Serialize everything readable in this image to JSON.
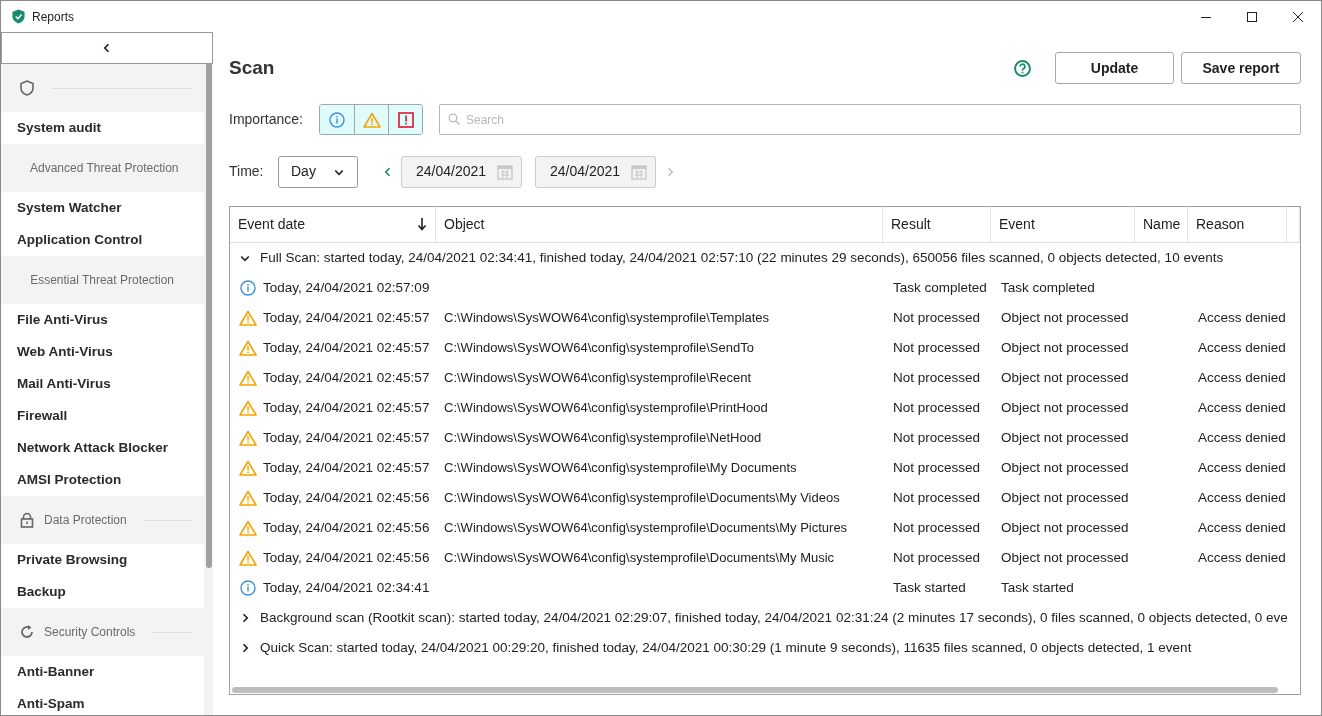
{
  "window": {
    "title": "Reports"
  },
  "sidebar": {
    "groups": [
      {
        "items": [
          "System audit"
        ]
      },
      {
        "label": "Advanced Threat Protection",
        "items": [
          "System Watcher",
          "Application Control"
        ]
      },
      {
        "label": "Essential Threat Protection",
        "items": [
          "File Anti-Virus",
          "Web Anti-Virus",
          "Mail Anti-Virus",
          "Firewall",
          "Network Attack Blocker",
          "AMSI Protection"
        ]
      },
      {
        "label": "Data Protection",
        "items": [
          "Private Browsing",
          "Backup"
        ]
      },
      {
        "label": "Security Controls",
        "items": [
          "Anti-Banner",
          "Anti-Spam"
        ]
      }
    ]
  },
  "page": {
    "title": "Scan",
    "buttons": [
      "Update",
      "Save report"
    ]
  },
  "importance": {
    "label": "Importance:",
    "filters": [
      {
        "kind": "info",
        "selected": true
      },
      {
        "kind": "warning",
        "selected": true
      },
      {
        "kind": "error",
        "selected": true
      }
    ]
  },
  "search": {
    "placeholder": "Search"
  },
  "time": {
    "label": "Time:",
    "period": "Day",
    "from": "24/04/2021",
    "to": "24/04/2021"
  },
  "table": {
    "columns": [
      "Event date",
      "Object",
      "Result",
      "Event",
      "Name",
      "Reason"
    ],
    "groups": [
      {
        "expanded": true,
        "text": "Full Scan: started today, 24/04/2021 02:34:41, finished today, 24/04/2021 02:57:10 (22 minutes 29 seconds), 650056 files scanned, 0 objects detected, 10 events",
        "rows": [
          {
            "kind": "info",
            "date": "Today, 24/04/2021 02:57:09",
            "result": "Task completed",
            "event": "Task completed"
          },
          {
            "kind": "warning",
            "date": "Today, 24/04/2021 02:45:57",
            "object": "C:\\Windows\\SysWOW64\\config\\systemprofile\\Templates",
            "result": "Not processed",
            "event": "Object not processed",
            "reason": "Access denied"
          },
          {
            "kind": "warning",
            "date": "Today, 24/04/2021 02:45:57",
            "object": "C:\\Windows\\SysWOW64\\config\\systemprofile\\SendTo",
            "result": "Not processed",
            "event": "Object not processed",
            "reason": "Access denied"
          },
          {
            "kind": "warning",
            "date": "Today, 24/04/2021 02:45:57",
            "object": "C:\\Windows\\SysWOW64\\config\\systemprofile\\Recent",
            "result": "Not processed",
            "event": "Object not processed",
            "reason": "Access denied"
          },
          {
            "kind": "warning",
            "date": "Today, 24/04/2021 02:45:57",
            "object": "C:\\Windows\\SysWOW64\\config\\systemprofile\\PrintHood",
            "result": "Not processed",
            "event": "Object not processed",
            "reason": "Access denied"
          },
          {
            "kind": "warning",
            "date": "Today, 24/04/2021 02:45:57",
            "object": "C:\\Windows\\SysWOW64\\config\\systemprofile\\NetHood",
            "result": "Not processed",
            "event": "Object not processed",
            "reason": "Access denied"
          },
          {
            "kind": "warning",
            "date": "Today, 24/04/2021 02:45:57",
            "object": "C:\\Windows\\SysWOW64\\config\\systemprofile\\My Documents",
            "result": "Not processed",
            "event": "Object not processed",
            "reason": "Access denied"
          },
          {
            "kind": "warning",
            "date": "Today, 24/04/2021 02:45:56",
            "object": "C:\\Windows\\SysWOW64\\config\\systemprofile\\Documents\\My Videos",
            "result": "Not processed",
            "event": "Object not processed",
            "reason": "Access denied"
          },
          {
            "kind": "warning",
            "date": "Today, 24/04/2021 02:45:56",
            "object": "C:\\Windows\\SysWOW64\\config\\systemprofile\\Documents\\My Pictures",
            "result": "Not processed",
            "event": "Object not processed",
            "reason": "Access denied"
          },
          {
            "kind": "warning",
            "date": "Today, 24/04/2021 02:45:56",
            "object": "C:\\Windows\\SysWOW64\\config\\systemprofile\\Documents\\My Music",
            "result": "Not processed",
            "event": "Object not processed",
            "reason": "Access denied"
          },
          {
            "kind": "info",
            "date": "Today, 24/04/2021 02:34:41",
            "result": "Task started",
            "event": "Task started"
          }
        ]
      },
      {
        "expanded": false,
        "text": "Background scan (Rootkit scan): started today, 24/04/2021 02:29:07, finished today, 24/04/2021 02:31:24 (2 minutes 17 seconds), 0 files scanned, 0 objects detected, 0 eve"
      },
      {
        "expanded": false,
        "text": "Quick Scan: started today, 24/04/2021 00:29:20, finished today, 24/04/2021 00:30:29 (1 minute 9 seconds), 11635 files scanned, 0 objects detected, 1 event"
      }
    ]
  }
}
